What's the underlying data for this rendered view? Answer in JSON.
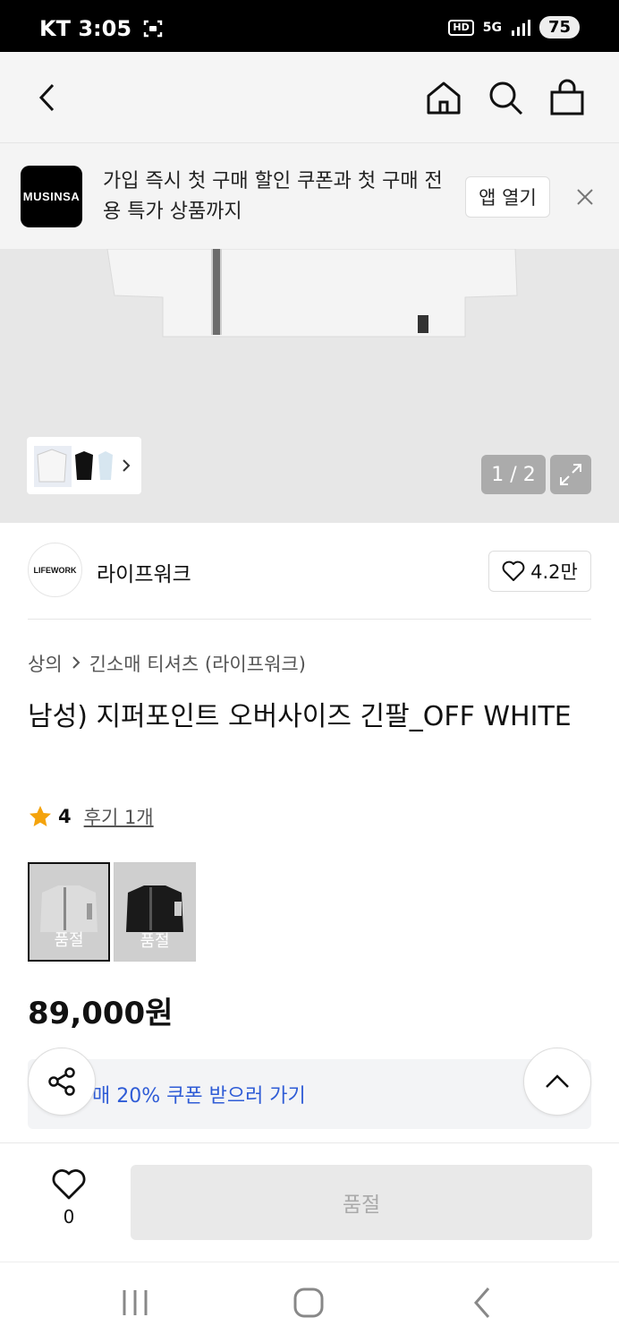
{
  "status_bar": {
    "carrier_time": "KT 3:05",
    "hd": "HD",
    "network": "5G",
    "battery": "75"
  },
  "banner": {
    "logo_text": "MUSINSA",
    "message": "가입 즉시 첫 구매 할인 쿠폰과 첫 구매 전용 특가 상품까지",
    "open_app_label": "앱 열기"
  },
  "gallery": {
    "pager": "1 / 2"
  },
  "brand": {
    "logo_text": "LIFEWORK",
    "name": "라이프워크",
    "likes": "4.2만"
  },
  "breadcrumb": {
    "category": "상의",
    "subcategory": "긴소매 티셔츠 (라이프워크)"
  },
  "product": {
    "title": "남성) 지퍼포인트 오버사이즈 긴팔_OFF WHITE",
    "rating": "4",
    "review_link": "후기 1개",
    "price": "89,000원"
  },
  "swatches": [
    {
      "label": "품절",
      "color": "#d6d6d6"
    },
    {
      "label": "품절",
      "color": "#1a1a1a"
    }
  ],
  "coupon": {
    "text": "매 20% 쿠폰 받으러 가기"
  },
  "bottom": {
    "wish_count": "0",
    "buy_label": "품절"
  },
  "colors": {
    "coupon_text": "#2f5cd6",
    "star": "#f4a30c"
  }
}
